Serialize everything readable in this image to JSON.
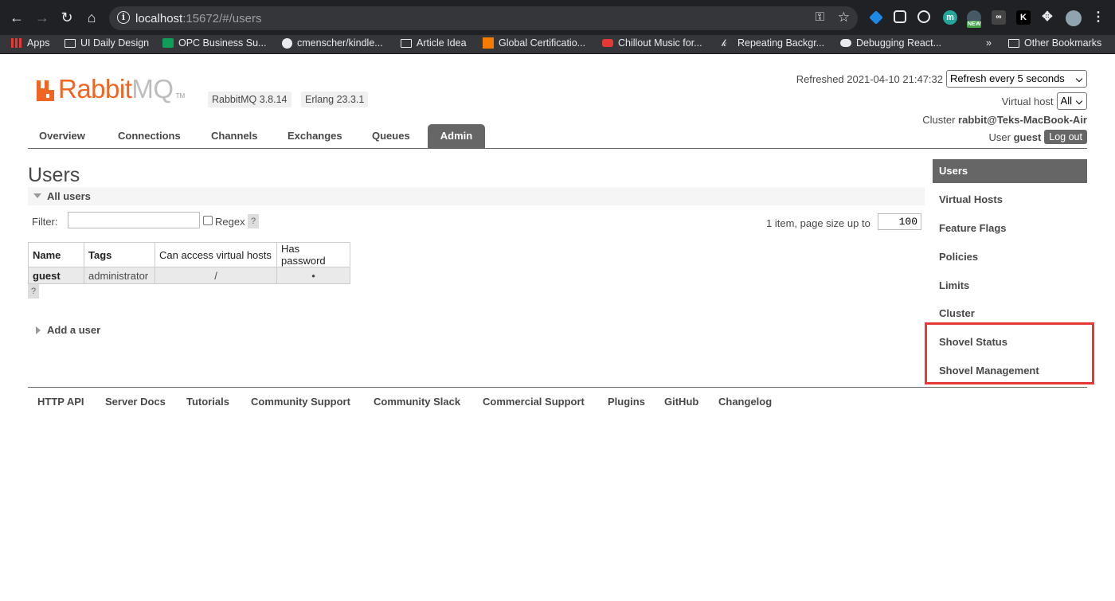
{
  "browser": {
    "url_host": "localhost",
    "url_rest": ":15672/#/users",
    "bookmarks": [
      {
        "label": "Apps",
        "icon": "apps-grid-icon"
      },
      {
        "label": "UI Daily Design",
        "icon": "folder-icon"
      },
      {
        "label": "OPC Business Su...",
        "icon": "sheet-icon"
      },
      {
        "label": "cmenscher/kindle...",
        "icon": "github-icon"
      },
      {
        "label": "Article Idea",
        "icon": "folder-icon"
      },
      {
        "label": "Global Certificatio...",
        "icon": "cube-icon"
      },
      {
        "label": "Chillout Music for...",
        "icon": "youtube-icon"
      },
      {
        "label": "Repeating Backgr...",
        "icon": "k-icon"
      },
      {
        "label": "Debugging React...",
        "icon": "medium-icon"
      },
      {
        "label": "Other Bookmarks",
        "icon": "folder-icon"
      }
    ],
    "more": "»",
    "ext_new": "NEW"
  },
  "header": {
    "logo_rabbit": "Rabbit",
    "logo_mq": "MQ",
    "logo_tm": "TM",
    "version": "RabbitMQ 3.8.14",
    "erlang": "Erlang 23.3.1",
    "refreshed_label": "Refreshed 2021-04-10 21:47:32",
    "refresh_select": "Refresh every 5 seconds",
    "vhost_label": "Virtual host",
    "vhost_select": "All",
    "cluster_label": "Cluster",
    "cluster_value": "rabbit@Teks-MacBook-Air",
    "user_label": "User",
    "user_value": "guest",
    "logout": "Log out"
  },
  "tabs": [
    "Overview",
    "Connections",
    "Channels",
    "Exchanges",
    "Queues",
    "Admin"
  ],
  "main": {
    "title": "Users",
    "section": "All users",
    "filter_label": "Filter:",
    "regex_label": "Regex",
    "help": "?",
    "pager": "1 item, page size up to",
    "page_size": "100",
    "columns": [
      "Name",
      "Tags",
      "Can access virtual hosts",
      "Has password"
    ],
    "rows": [
      {
        "name": "guest",
        "tags": "administrator",
        "vhosts": "/",
        "has_password": "•"
      }
    ],
    "add_user": "Add a user"
  },
  "sidebar": [
    "Users",
    "Virtual Hosts",
    "Feature Flags",
    "Policies",
    "Limits",
    "Cluster",
    "Shovel Status",
    "Shovel Management"
  ],
  "footer": [
    "HTTP API",
    "Server Docs",
    "Tutorials",
    "Community Support",
    "Community Slack",
    "Commercial Support",
    "Plugins",
    "GitHub",
    "Changelog"
  ],
  "colors": {
    "accent": "#f16523",
    "tab_active": "#666666",
    "highlight": "#e53935"
  }
}
